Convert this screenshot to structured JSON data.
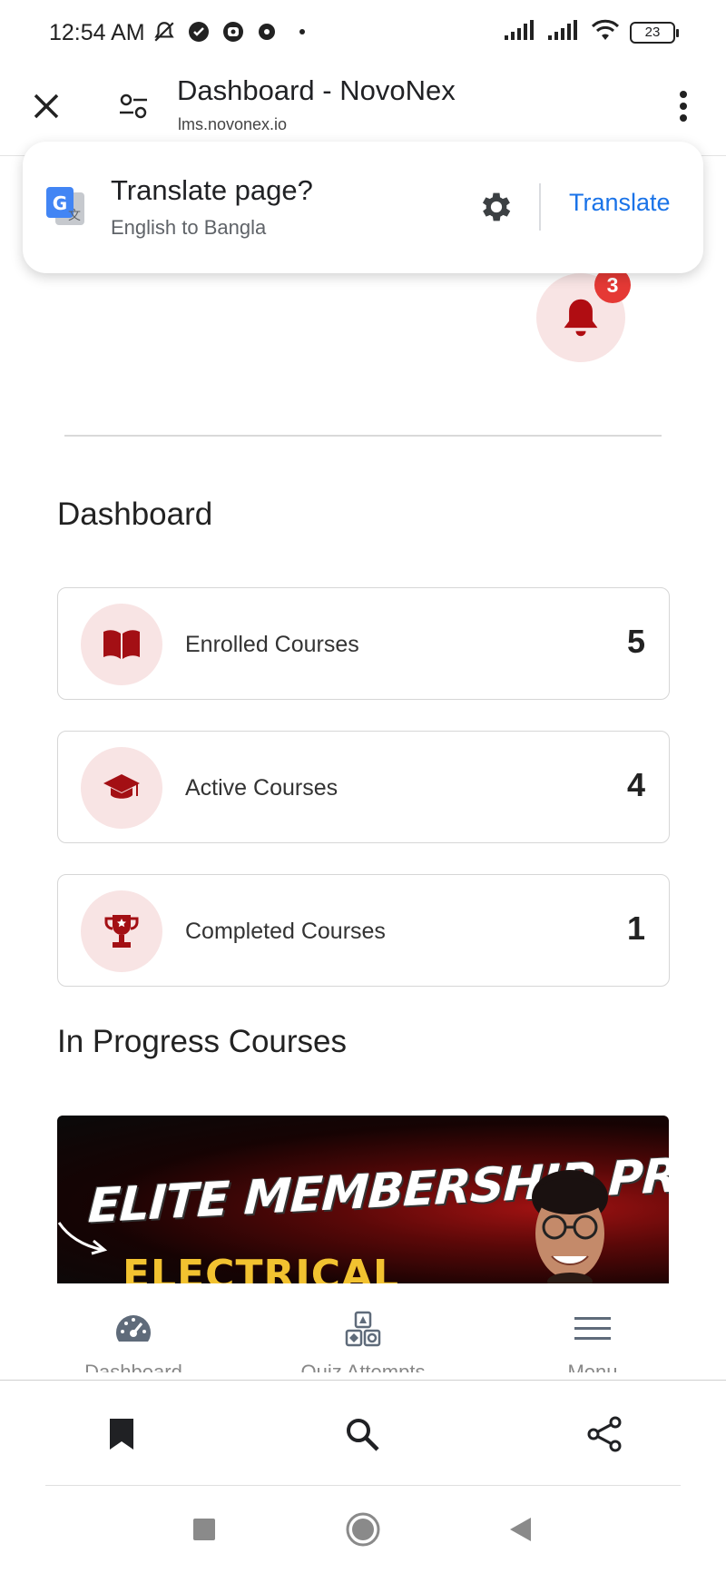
{
  "status_bar": {
    "time": "12:54 AM",
    "battery": "23"
  },
  "browser": {
    "page_title": "Dashboard - NovoNex",
    "url": "lms.novonex.io"
  },
  "translate_popup": {
    "title": "Translate page?",
    "subtitle": "English to Bangla",
    "button": "Translate"
  },
  "notifications": {
    "count": "3"
  },
  "dashboard": {
    "heading": "Dashboard",
    "stats": [
      {
        "label": "Enrolled Courses",
        "value": "5",
        "icon": "book-icon"
      },
      {
        "label": "Active Courses",
        "value": "4",
        "icon": "graduation-cap-icon"
      },
      {
        "label": "Completed Courses",
        "value": "1",
        "icon": "trophy-icon"
      }
    ]
  },
  "in_progress": {
    "heading": "In Progress Courses",
    "banner_title": "ELITE MEMBERSHIP PROGRAM",
    "banner_subtitle": "ELECTRICAL"
  },
  "site_nav": {
    "items": [
      {
        "label": "Dashboard",
        "icon": "gauge-icon"
      },
      {
        "label": "Quiz Attempts",
        "icon": "shapes-icon"
      },
      {
        "label": "Menu",
        "icon": "hamburger-icon"
      }
    ]
  },
  "colors": {
    "accent": "#a30f14",
    "accent_soft": "#f8e4e4",
    "link_blue": "#1a73e8",
    "badge_red": "#e53935"
  }
}
